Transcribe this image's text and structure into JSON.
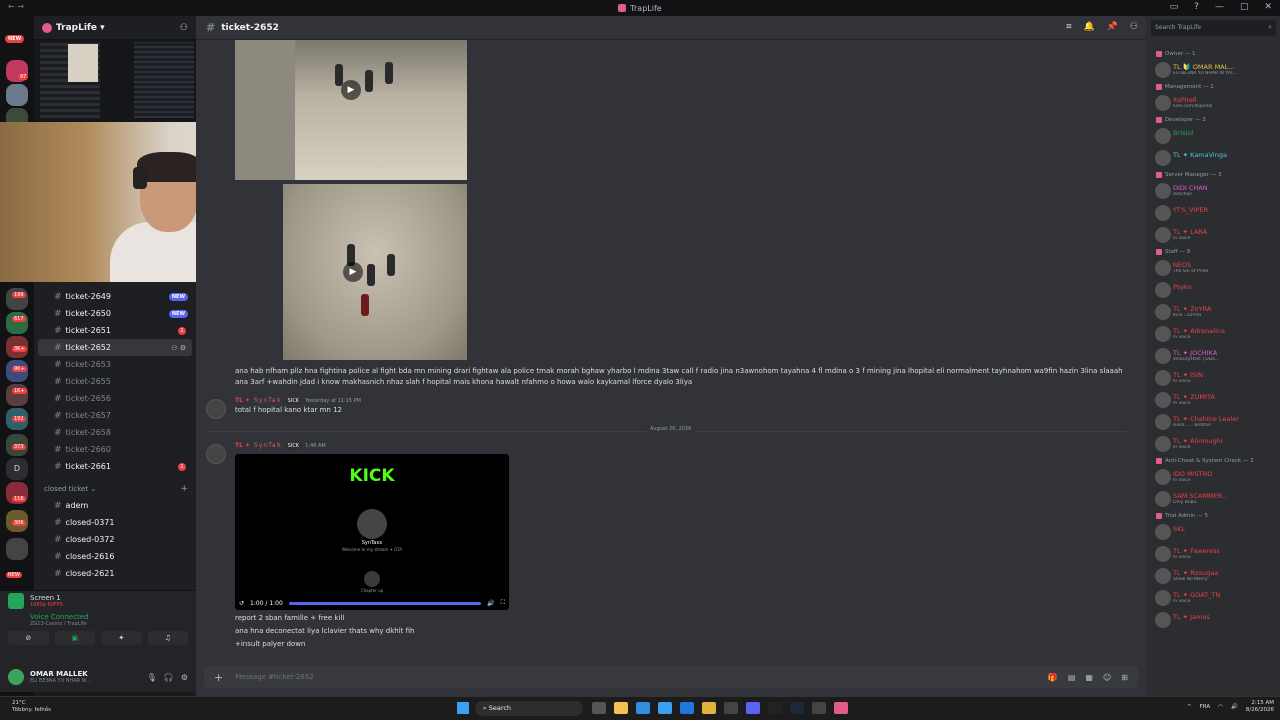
{
  "window": {
    "title": "TrapLife",
    "left_controls": "← →",
    "right_controls": [
      "▭",
      "?",
      "—",
      "▢",
      "✕"
    ]
  },
  "server": {
    "name": "TrapLife ▾",
    "new_badge": "NEW"
  },
  "rail_pills": [
    "97",
    "199",
    "617",
    "3K+",
    "9K+",
    "1K+",
    "192",
    "373",
    "116",
    "306",
    "NEW"
  ],
  "rail_letter": "D",
  "channels": {
    "items": [
      {
        "name": "ticket-2649",
        "badge": "NEW",
        "kind": "new"
      },
      {
        "name": "ticket-2650",
        "badge": "NEW",
        "kind": "new"
      },
      {
        "name": "ticket-2651",
        "badge": "1",
        "kind": "count"
      },
      {
        "name": "ticket-2652",
        "badge": "",
        "kind": "selected"
      },
      {
        "name": "ticket-2653",
        "badge": "",
        "kind": "dim"
      },
      {
        "name": "ticket-2655",
        "badge": "",
        "kind": "dim"
      },
      {
        "name": "ticket-2656",
        "badge": "",
        "kind": "dim"
      },
      {
        "name": "ticket-2657",
        "badge": "",
        "kind": "dim"
      },
      {
        "name": "ticket-2658",
        "badge": "",
        "kind": "dim"
      },
      {
        "name": "ticket-2660",
        "badge": "",
        "kind": "dim"
      },
      {
        "name": "ticket-2661",
        "badge": "1",
        "kind": "count"
      }
    ],
    "category": "closed ticket ⌄",
    "closed": [
      "adem",
      "closed-0371",
      "closed-0372",
      "closed-2616",
      "closed-2621"
    ]
  },
  "voice": {
    "screen_label": "Screen 1",
    "screen_sub": "1080p 60FPS",
    "connected": "Voice Connected",
    "channel": "ZG13-Casino / TrapLife"
  },
  "user": {
    "name": "OMAR MALLEK",
    "status": "ELI BE3NA Y.II NHAR W..."
  },
  "main": {
    "channel": "ticket-2652",
    "long_message": "ana hab nfham pllz hna fightina police al fight bda mn mining drari fightaw ala police tmak morah bghaw yharbo l mdina 3taw call f radio jina n3awnohom tayahna 4 fl mdina o 3 f mining jina lhopital eli normalment tayhnahom wa9fin hazin 3lina slaaah ana 3arf +wahdin jdad i know makhasnich nhaz slah f hopital mais khona hawalt nfahmo o howa walo kaykamal lforce dyalo 3liya",
    "msg1": {
      "tag": "TL ✦",
      "name": "SynTaX",
      "badge": "SICK",
      "time": "Yesterday at 11:15 PM",
      "text": "total f hopital kano ktar mn 12"
    },
    "date_divider": "August 26, 2026",
    "msg2": {
      "tag": "TL ✦",
      "name": "SynTaX",
      "badge": "SICK",
      "time": "1:48 AM"
    },
    "video": {
      "brand": "KICK",
      "name": "SynTaxx",
      "sub": "Welcome to my stream ✦ GTA",
      "sub2": "Chapter up",
      "time": "1:00 / 1:00"
    },
    "lines": [
      "report 2 sban famille + free kill",
      "ana hna deconectat liya lclavier thats why dkhlt fih",
      "+insult palyer down"
    ],
    "composer_placeholder": "Message #ticket-2652"
  },
  "members": {
    "search_placeholder": "Search TrapLife",
    "groups": [
      {
        "role": "Owner — 1",
        "members": [
          {
            "name": "TL 🔰 OMAR MAL...",
            "status": "ELI BE3NA Y.II NHAR W YAT...",
            "color": "#e0c341"
          }
        ]
      },
      {
        "role": "Management — 1",
        "members": [
          {
            "name": "ItsPirell",
            "status": "kick.com/itspirelli",
            "color": "#ed4245"
          }
        ]
      },
      {
        "role": "Developer — 2",
        "members": [
          {
            "name": "Bristol",
            "status": "",
            "color": "#23a55a"
          },
          {
            "name": "TL ✦ KamaVinga",
            "status": "",
            "color": "#4fc6d6"
          }
        ]
      },
      {
        "role": "Server Manager — 3",
        "members": [
          {
            "name": "DIDI CHAN",
            "status": "didichan",
            "color": "#e05cc6"
          },
          {
            "name": "ˡIT'S_VIPER",
            "status": "",
            "color": "#ed4245"
          },
          {
            "name": "TL ✦ LARA",
            "status": "In voice",
            "color": "#ed4245"
          }
        ]
      },
      {
        "role": "Staff — 9",
        "members": [
          {
            "name": "NEOS",
            "status": "The Sin of Pride",
            "color": "#ed4245"
          },
          {
            "name": "Psyko",
            "status": "",
            "color": "#ed4245"
          },
          {
            "name": "TL ✦ ZoYRA",
            "status": "Kick : ZoYRa",
            "color": "#ed4245"
          },
          {
            "name": "TL ✦ Adrenalina",
            "status": "In voice",
            "color": "#ed4245"
          },
          {
            "name": "TL ✦ JOCHIKA",
            "status": "VelocityHost | DDo...",
            "color": "#e05cc6"
          },
          {
            "name": "TL ✦ ISIN",
            "status": "In voice",
            "color": "#ed4245"
          },
          {
            "name": "TL ✦ ZUMITA",
            "status": "In voice",
            "color": "#ed4245"
          },
          {
            "name": "TL ✦ Chahine Lealer",
            "status": "Hello ..... Brother",
            "color": "#ed4245"
          },
          {
            "name": "TL ✦ Alimoughi",
            "status": "In voice",
            "color": "#ed4245"
          }
        ]
      },
      {
        "role": "Anti-Cheat & System Check — 2",
        "members": [
          {
            "name": "IDO MISTRO",
            "status": "In voice",
            "color": "#ed4245"
          },
          {
            "name": "SAM SCAMMER...",
            "status": "Only BuBu",
            "color": "#ed4245"
          }
        ]
      },
      {
        "role": "Trial Admin — 5",
        "members": [
          {
            "name": "SKL",
            "status": "",
            "color": "#ed4245"
          },
          {
            "name": "TL ✦ Faweress",
            "status": "In voice",
            "color": "#ed4245"
          },
          {
            "name": "TL ✦ Rzougaa",
            "status": "Show No Mercy",
            "color": "#ed4245"
          },
          {
            "name": "TL ✦ GOAT_TN",
            "status": "In voice",
            "color": "#ed4245"
          },
          {
            "name": "TL ✦ James",
            "status": "",
            "color": "#ed4245"
          }
        ]
      }
    ]
  },
  "taskbar": {
    "weather_temp": "21°C",
    "weather_desc": "Többny. felhős",
    "search": "Search",
    "lang": "FRA",
    "time": "2:15 AM",
    "date": "8/26/2026"
  },
  "colors": {
    "accent": "#5865f2",
    "danger": "#ed4245",
    "online": "#23a55a",
    "kick": "#53fc18"
  }
}
